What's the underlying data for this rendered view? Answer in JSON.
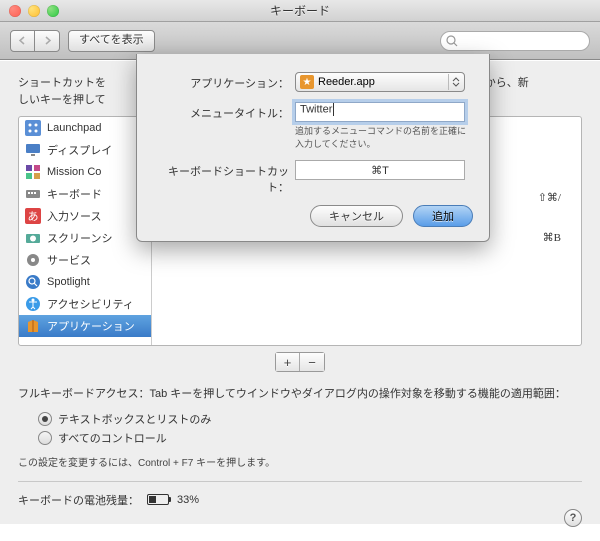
{
  "title": "キーボード",
  "toolbar": {
    "show_all": "すべてを表示"
  },
  "sheet": {
    "app_label": "アプリケーション：",
    "app_value": "Reeder.app",
    "menu_label": "メニュータイトル：",
    "menu_value": "Twitter",
    "menu_hint": "追加するメニューコマンドの名前を正確に入力してください。",
    "shortcut_label": "キーボードショートカット：",
    "shortcut_value": "⌘T",
    "cancel": "キャンセル",
    "add": "追加"
  },
  "info_text": "ショートカットを変更するには、ショートカットを選択し、キーコンビネーションをクリックしてから、新しいキーを押してください。",
  "info_text_visible_a": "ショートカットを",
  "info_text_visible_b": "クしてから、新",
  "info_text_visible_c": "しいキーを押して",
  "sidebar": {
    "items": [
      {
        "label": "Launchpad"
      },
      {
        "label": "ディスプレイ"
      },
      {
        "label": "Mission Co"
      },
      {
        "label": "キーボード"
      },
      {
        "label": "入力ソース"
      },
      {
        "label": "スクリーンシ"
      },
      {
        "label": "サービス"
      },
      {
        "label": "Spotlight"
      },
      {
        "label": "アクセシビリティ"
      },
      {
        "label": "アプリケーション"
      }
    ]
  },
  "shortcuts_visible": {
    "s1": "⇧⌘/",
    "s2": "⌘B"
  },
  "fk_text": "フルキーボードアクセス：Tab キーを押してウインドウやダイアログ内の操作対象を移動する機能の適用範囲：",
  "radio1": "テキストボックスとリストのみ",
  "radio2": "すべてのコントロール",
  "hint": "この設定を変更するには、Control + F7 キーを押します。",
  "battery": {
    "label": "キーボードの電池残量：",
    "value": "33%"
  }
}
